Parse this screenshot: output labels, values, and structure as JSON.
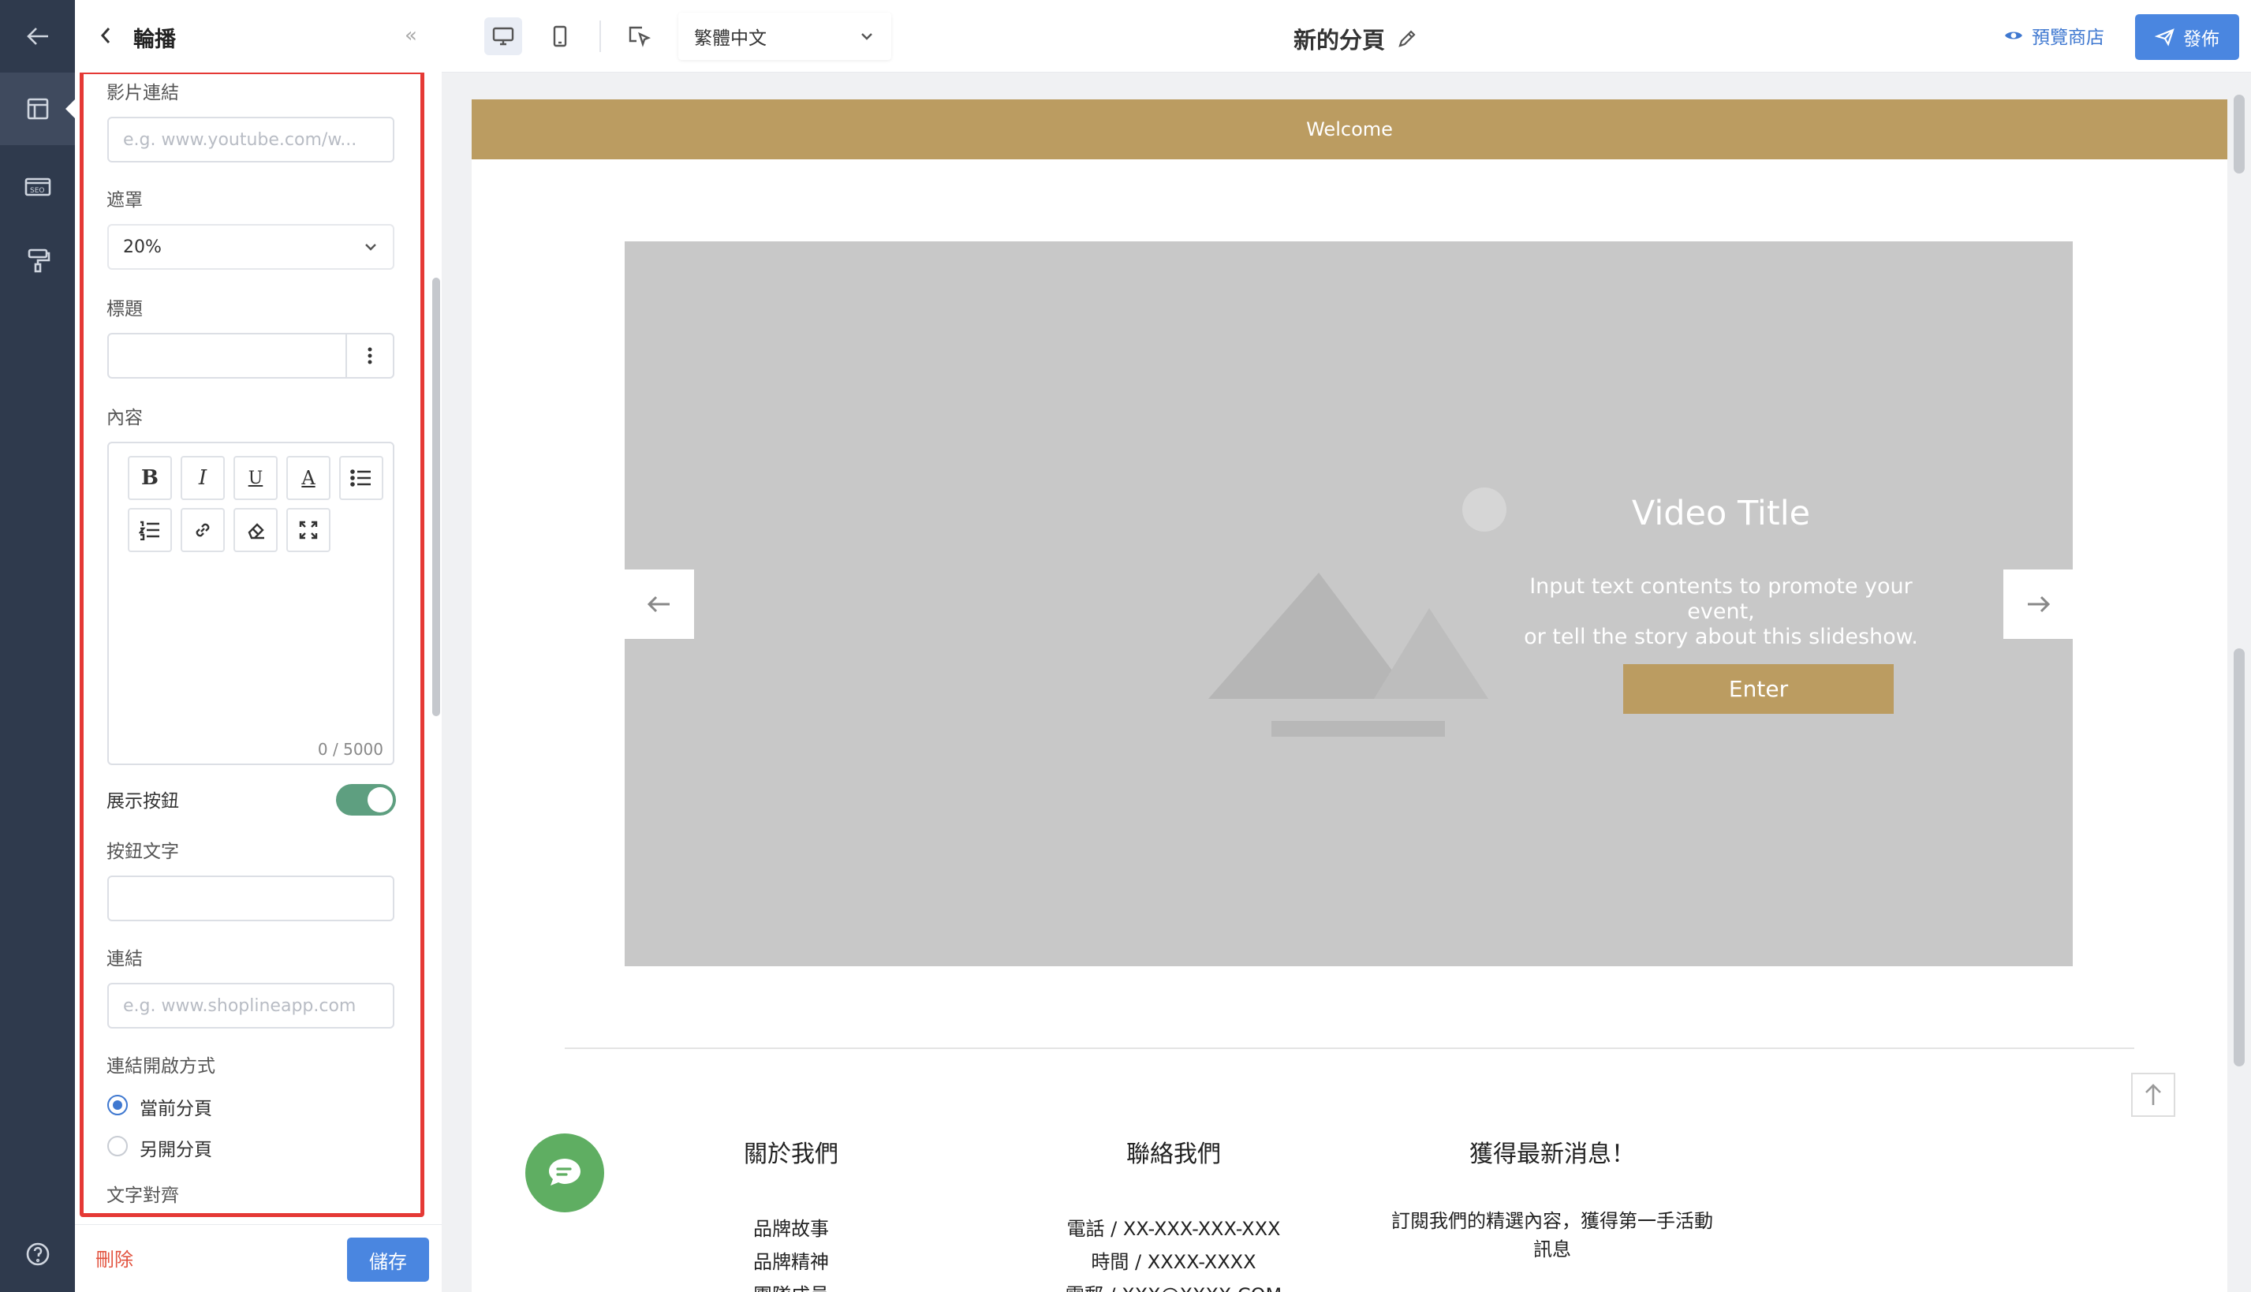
{
  "rail": {
    "icons": [
      "back-arrow-icon",
      "layout-icon",
      "seo-icon",
      "paint-roller-icon",
      "help-icon"
    ]
  },
  "panel": {
    "title": "輪播",
    "video_link_label": "影片連結",
    "video_link_placeholder": "e.g. www.youtube.com/w...",
    "overlay_label": "遮罩",
    "overlay_value": "20%",
    "heading_label": "標題",
    "content_label": "內容",
    "char_count": "0 / 5000",
    "toolbar": {
      "bold": "B",
      "italic": "I",
      "underline": "U",
      "color": "A"
    },
    "show_button_label": "展示按鈕",
    "show_button_on": true,
    "button_text_label": "按鈕文字",
    "link_label": "連結",
    "link_placeholder": "e.g. www.shoplineapp.com",
    "open_mode_label": "連結開啟方式",
    "open_current": "當前分頁",
    "open_new": "另開分頁",
    "text_align_label": "文字對齊",
    "delete": "刪除",
    "save": "儲存"
  },
  "topbar": {
    "language": "繁體中文",
    "page_title": "新的分頁",
    "preview_store": "預覽商店",
    "publish": "發佈"
  },
  "preview": {
    "welcome": "Welcome",
    "slide_title": "Video Title",
    "slide_desc_1": "Input text contents to promote your event,",
    "slide_desc_2": "or tell the story about this slideshow.",
    "slide_button": "Enter",
    "footer": {
      "about_title": "關於我們",
      "about_items": [
        "品牌故事",
        "品牌精神",
        "團隊成員"
      ],
      "contact_title": "聯絡我們",
      "contact_items": [
        "電話 / XX-XXX-XXX-XXX",
        "時間 / XXXX-XXXX",
        "電郵 / XXX@XXXX.COM"
      ],
      "news_title": "獲得最新消息！",
      "news_text_1": "訂閱我們的精選內容，獲得第一手活動",
      "news_text_2": "訊息"
    }
  },
  "colors": {
    "accent_gold": "#bb9c61",
    "primary_blue": "#4a86e0",
    "danger": "#e53935",
    "toggle_green": "#5e9f80",
    "rail_bg": "#2f3a4d"
  }
}
